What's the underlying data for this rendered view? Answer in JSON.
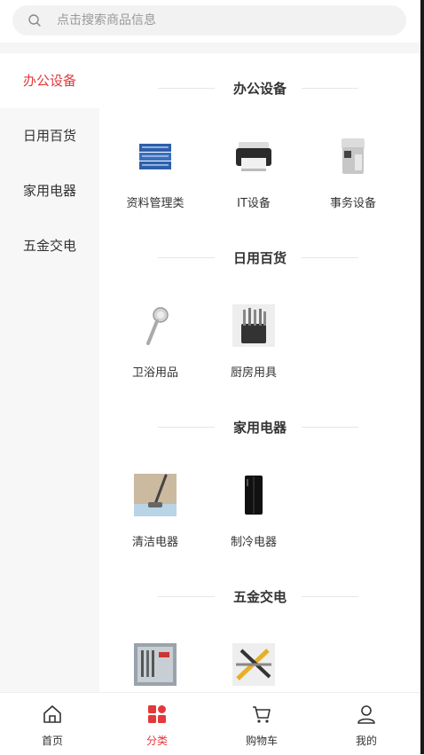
{
  "search": {
    "placeholder": "点击搜索商品信息"
  },
  "colors": {
    "accent": "#e4393c"
  },
  "sidebar": {
    "items": [
      {
        "label": "办公设备",
        "active": true
      },
      {
        "label": "日用百货",
        "active": false
      },
      {
        "label": "家用电器",
        "active": false
      },
      {
        "label": "五金交电",
        "active": false
      }
    ]
  },
  "sections": [
    {
      "title": "办公设备",
      "items": [
        {
          "label": "资料管理类",
          "icon": "file-storage-icon"
        },
        {
          "label": "IT设备",
          "icon": "printer-icon"
        },
        {
          "label": "事务设备",
          "icon": "shredder-icon"
        }
      ]
    },
    {
      "title": "日用百货",
      "items": [
        {
          "label": "卫浴用品",
          "icon": "shower-head-icon"
        },
        {
          "label": "厨房用具",
          "icon": "knife-set-icon"
        }
      ]
    },
    {
      "title": "家用电器",
      "items": [
        {
          "label": "清洁电器",
          "icon": "floor-cleaner-icon"
        },
        {
          "label": "制冷电器",
          "icon": "refrigerator-icon"
        }
      ]
    },
    {
      "title": "五金交电",
      "items": [
        {
          "label": "",
          "icon": "toolbox-icon"
        },
        {
          "label": "",
          "icon": "tool-set-icon"
        }
      ]
    }
  ],
  "tabbar": {
    "items": [
      {
        "label": "首页",
        "icon": "home-icon",
        "active": false
      },
      {
        "label": "分类",
        "icon": "category-icon",
        "active": true
      },
      {
        "label": "购物车",
        "icon": "cart-icon",
        "active": false
      },
      {
        "label": "我的",
        "icon": "user-icon",
        "active": false
      }
    ]
  }
}
